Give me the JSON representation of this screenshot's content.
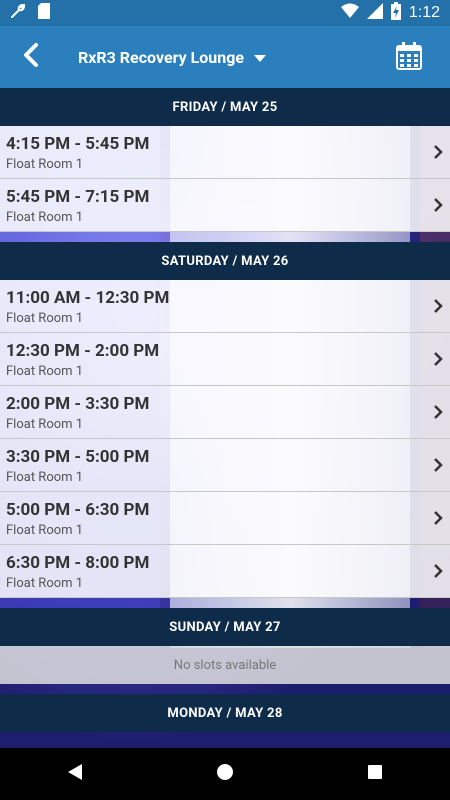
{
  "status_bar": {
    "time": "1:12",
    "icons": [
      "wrench-icon",
      "sd-card-icon",
      "wifi-icon",
      "signal-icon",
      "battery-charging-icon"
    ]
  },
  "app_bar": {
    "back_icon": "chevron-left-icon",
    "title": "RxR3 Recovery Lounge",
    "dropdown_icon": "caret-down-icon",
    "calendar_icon": "calendar-icon",
    "background_color": "#2b7fbd"
  },
  "schedule": [
    {
      "day_label": "FRIDAY / MAY 25",
      "slots": [
        {
          "time": "4:15 PM - 5:45 PM",
          "room": "Float Room 1"
        },
        {
          "time": "5:45 PM - 7:15 PM",
          "room": "Float Room 1"
        }
      ]
    },
    {
      "day_label": "SATURDAY / MAY 26",
      "slots": [
        {
          "time": "11:00 AM - 12:30 PM",
          "room": "Float Room 1"
        },
        {
          "time": "12:30 PM - 2:00 PM",
          "room": "Float Room 1"
        },
        {
          "time": "2:00 PM - 3:30 PM",
          "room": "Float Room 1"
        },
        {
          "time": "3:30 PM - 5:00 PM",
          "room": "Float Room 1"
        },
        {
          "time": "5:00 PM - 6:30 PM",
          "room": "Float Room 1"
        },
        {
          "time": "6:30 PM - 8:00 PM",
          "room": "Float Room 1"
        }
      ]
    },
    {
      "day_label": "SUNDAY / MAY 27",
      "empty_message": "No slots available",
      "slots": []
    },
    {
      "day_label": "MONDAY / MAY 28",
      "slots": []
    }
  ],
  "nav_bar": {
    "back_icon": "triangle-back-icon",
    "home_icon": "circle-home-icon",
    "recents_icon": "square-recents-icon"
  },
  "colors": {
    "status_bar": "#2470a8",
    "day_header": "#0e2b4a"
  }
}
